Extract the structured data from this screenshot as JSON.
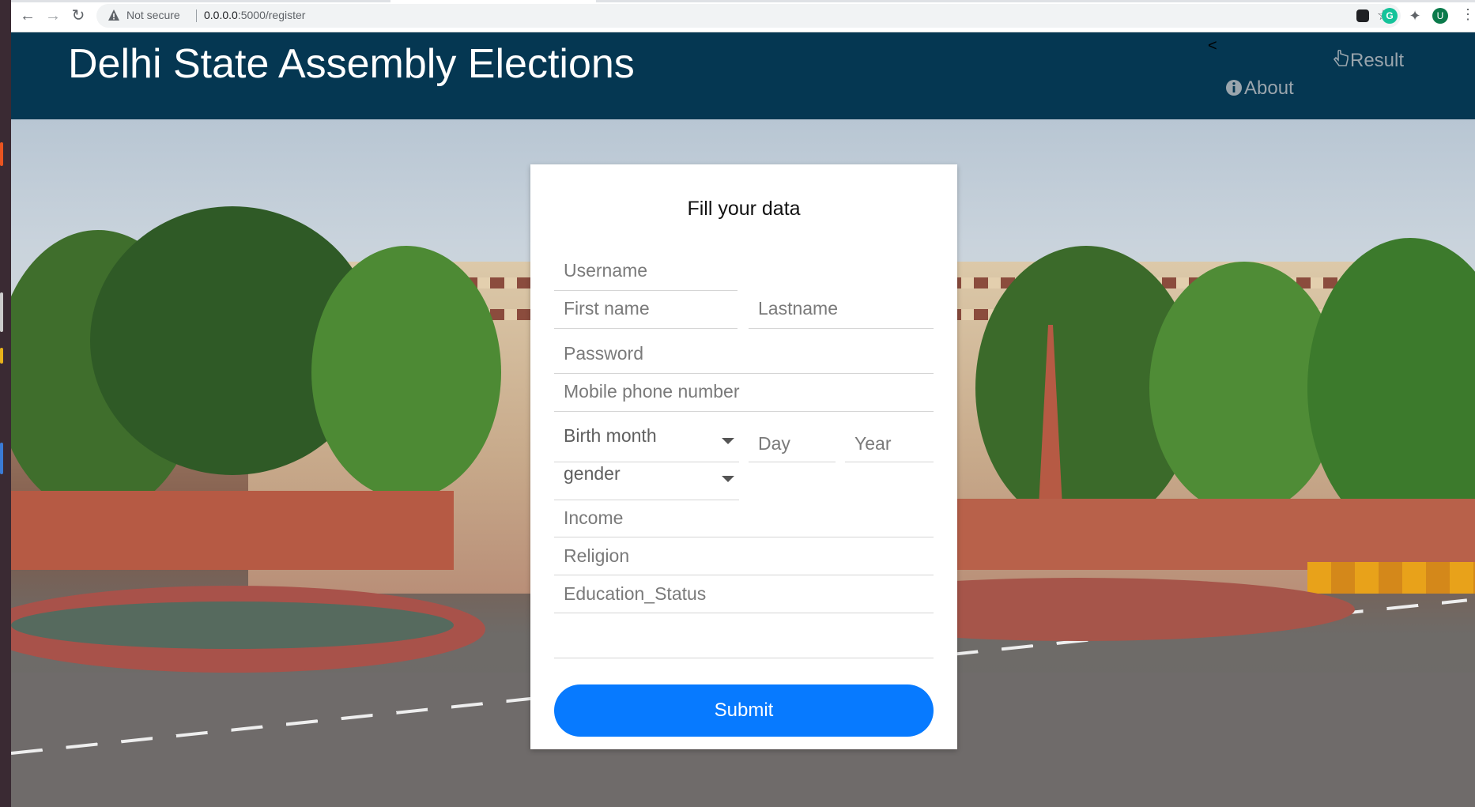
{
  "browser": {
    "security_label": "Not secure",
    "url_host": "0.0.0.0",
    "url_path": ":5000/register",
    "ext_grammarly": "G",
    "profile_initial": "U"
  },
  "header": {
    "title": "Delhi State Assembly Elections",
    "toggle_glyph": "<",
    "nav": {
      "result": "Result",
      "about": "About"
    }
  },
  "form": {
    "title": "Fill your data",
    "username_placeholder": "Username",
    "firstname_placeholder": "First name",
    "lastname_placeholder": "Lastname",
    "password_placeholder": "Password",
    "mobile_placeholder": "Mobile phone number",
    "birth_month": "Birth month",
    "day_placeholder": "Day",
    "year_placeholder": "Year",
    "gender": "gender",
    "income_placeholder": "Income",
    "religion_placeholder": "Religion",
    "education_placeholder": "Education_Status",
    "submit_label": "Submit"
  },
  "colors": {
    "header_bg": "#053752",
    "submit_bg": "#077aff"
  }
}
